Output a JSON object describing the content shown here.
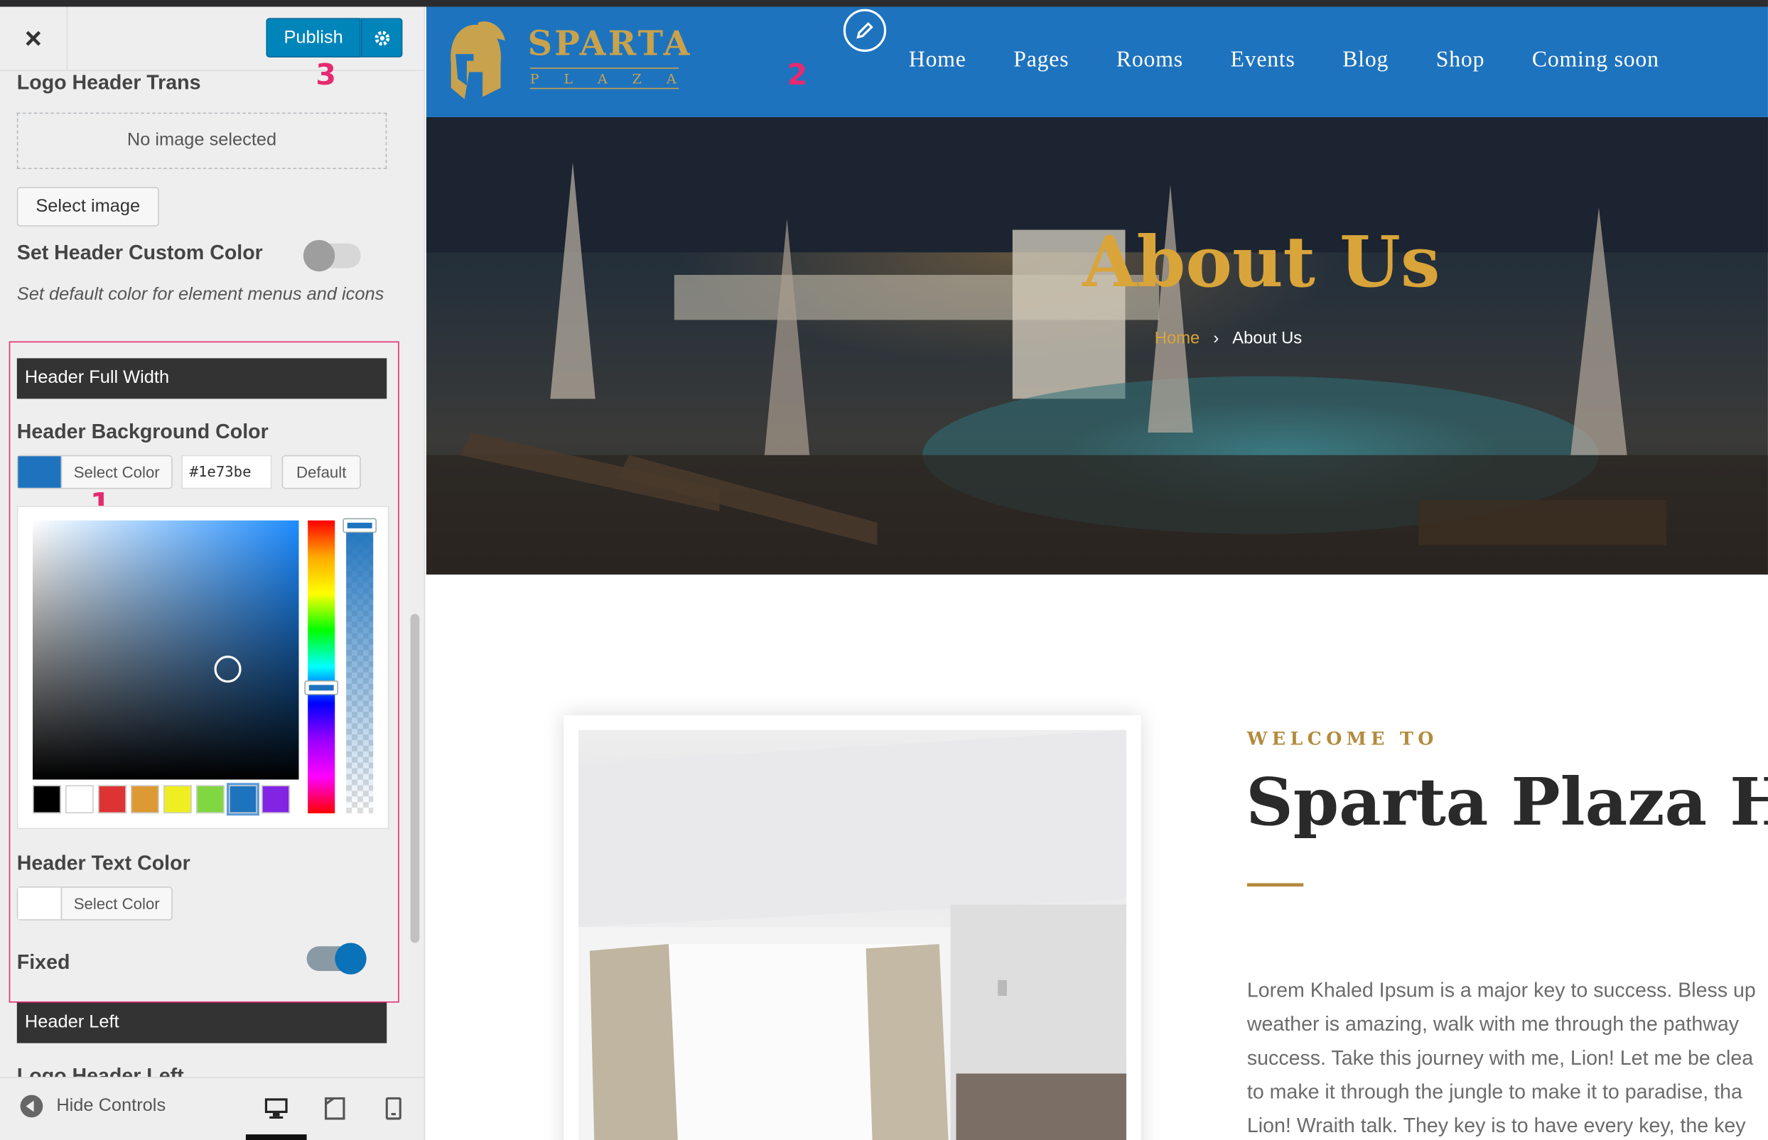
{
  "sidebar": {
    "close_label": "×",
    "publish_label": "Publish",
    "sections": {
      "logo_header_trans": "Logo Header Trans",
      "no_image": "No image selected",
      "select_image": "Select image",
      "set_header_custom_color": "Set Header Custom Color",
      "set_header_custom_color_desc": "Set default color for element menus and icons",
      "header_full_width": "Header Full Width",
      "header_bg_color": "Header Background Color",
      "select_color": "Select Color",
      "hex_value": "#1e73be",
      "default_label": "Default",
      "header_text_color": "Header Text Color",
      "fixed": "Fixed",
      "header_left": "Header Left",
      "logo_header_left": "Logo Header Left"
    },
    "toggles": {
      "set_header_custom_color": false,
      "fixed": true
    },
    "palette": [
      "#000000",
      "#ffffff",
      "#dd3333",
      "#dd9933",
      "#eeee22",
      "#81d742",
      "#1e73be",
      "#8224e3"
    ],
    "colors": {
      "header_bg": "#1e73be",
      "header_text": "#ffffff"
    },
    "footer": {
      "hide_controls": "Hide Controls",
      "devices": [
        "desktop-icon",
        "tablet-icon",
        "mobile-icon"
      ]
    },
    "markers": {
      "one": "1",
      "two": "2",
      "three": "3"
    }
  },
  "preview": {
    "logo": {
      "word": "SPARTA",
      "sub": "PLAZA"
    },
    "nav": [
      "Home",
      "Pages",
      "Rooms",
      "Events",
      "Blog",
      "Shop",
      "Coming soon"
    ],
    "hero": {
      "title": "About Us",
      "crumb_home": "Home",
      "crumb_sep": "›",
      "crumb_current": "About Us"
    },
    "welcome": "WELCOME TO",
    "hotel_title": "Sparta Plaza Hot",
    "lorem_lines": [
      "Lorem Khaled Ipsum is a major key to success. Bless up",
      "weather is amazing, walk with me through the pathway",
      "success. Take this journey with me, Lion! Let me be clea",
      "to make it through the jungle to make it to paradise, tha",
      "Lion! Wraith talk. They key is to have every key, the key"
    ]
  }
}
